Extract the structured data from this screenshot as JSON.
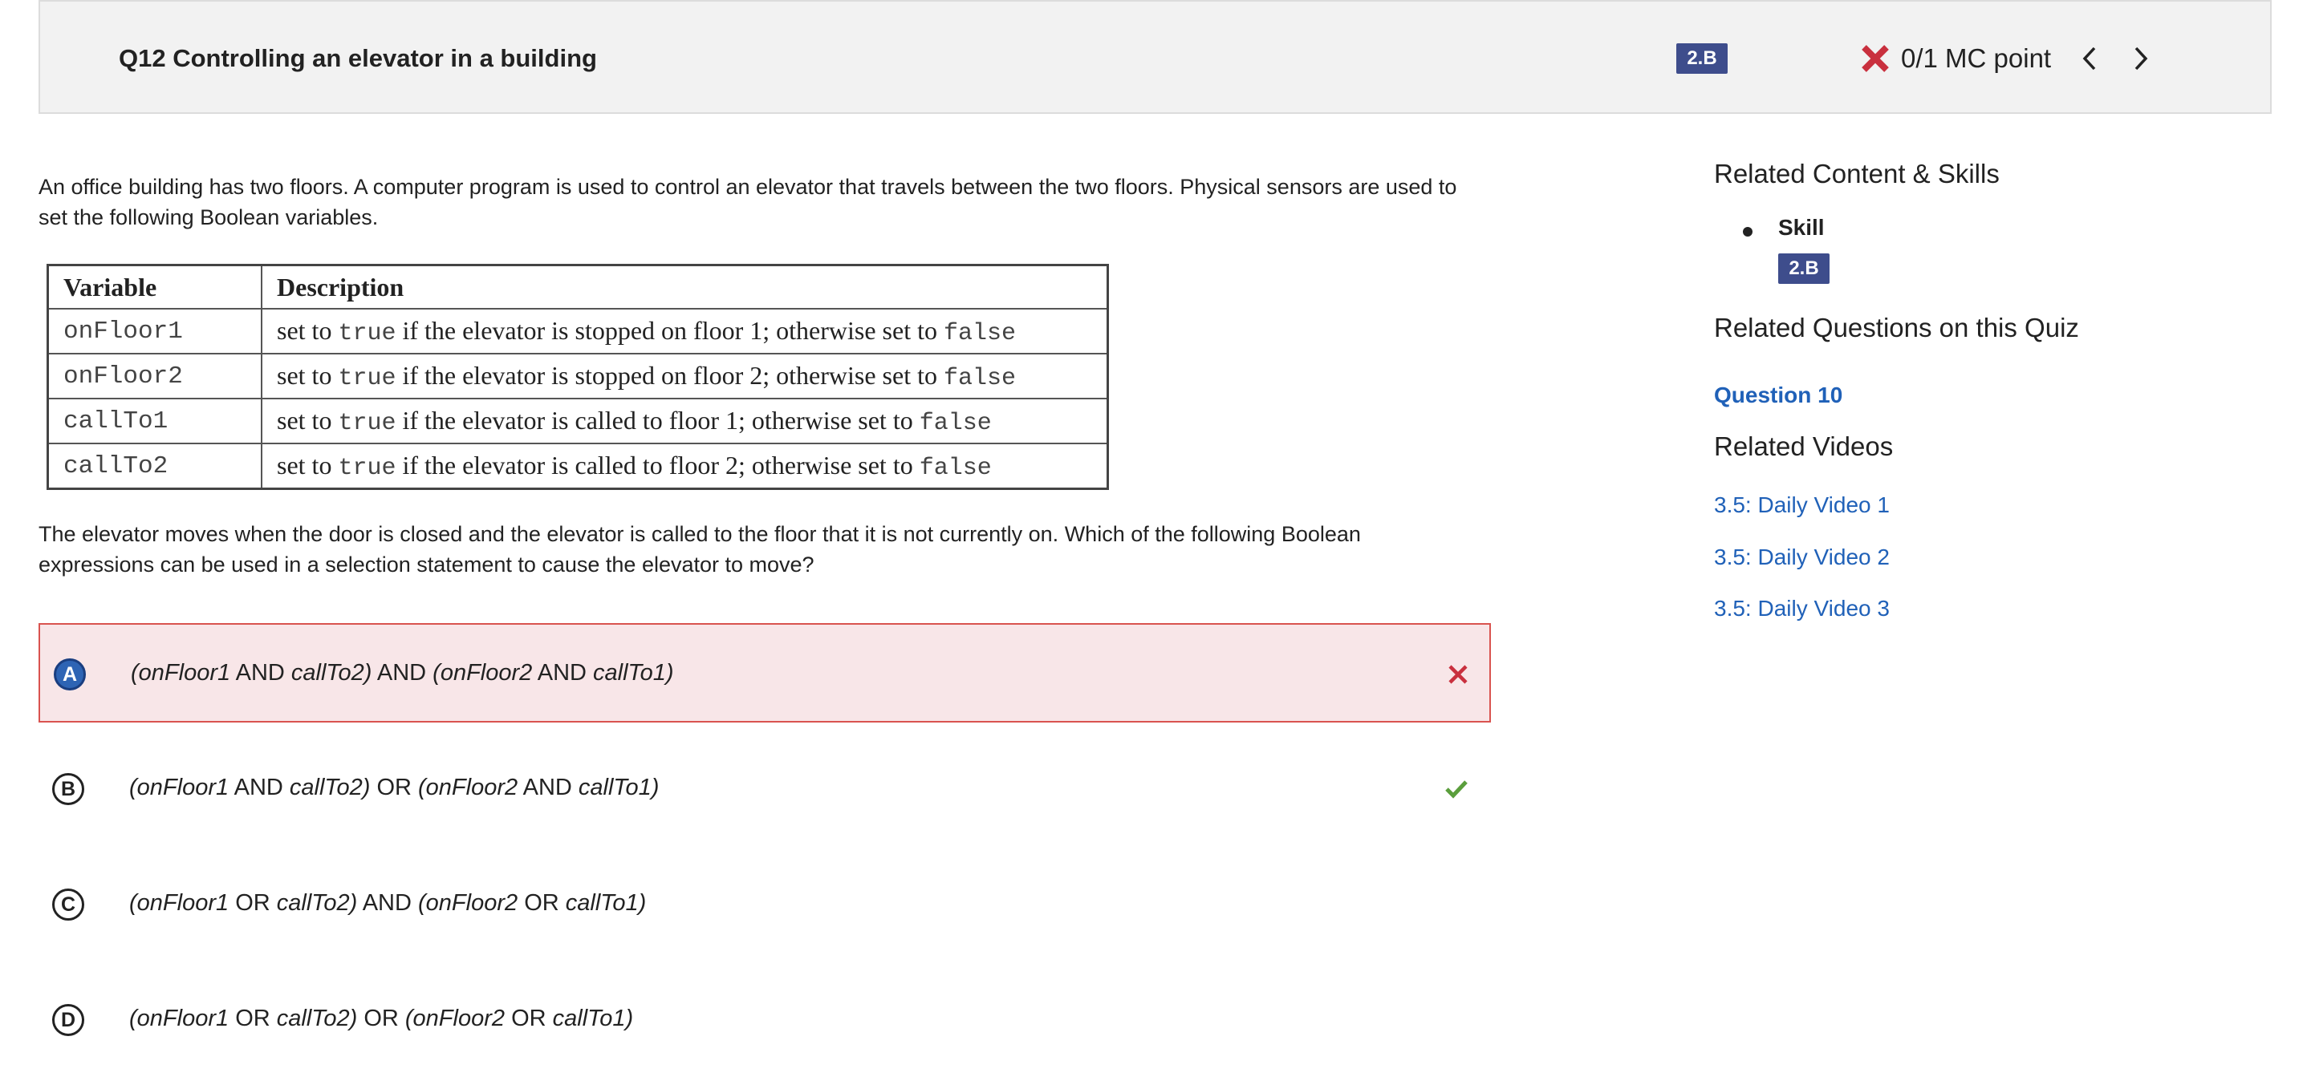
{
  "header": {
    "question_title": "Q12 Controlling an elevator in a building",
    "skill_badge": "2.B",
    "score_text": "0/1 MC point",
    "prev_icon": "chevron-left-icon",
    "next_icon": "chevron-right-icon",
    "status_icon": "x-mark-icon"
  },
  "question": {
    "prompt_intro": "An office building has two floors. A computer program is used to control an elevator that travels between the two floors. Physical sensors are used to set the following Boolean variables.",
    "prompt_question": "The elevator moves when the door is closed and the elevator is called to the floor that it is not currently on. Which of the following Boolean expressions can be used in a selection statement to cause the elevator to move?"
  },
  "variables_table": {
    "headers": [
      "Variable",
      "Description"
    ],
    "rows": [
      {
        "name": "onFloor1",
        "pre": "set to ",
        "true": "true",
        "mid": " if the elevator is stopped on floor 1; otherwise set to ",
        "false": "false"
      },
      {
        "name": "onFloor2",
        "pre": "set to ",
        "true": "true",
        "mid": " if the elevator is stopped on floor 2; otherwise set to ",
        "false": "false"
      },
      {
        "name": "callTo1",
        "pre": "set to ",
        "true": "true",
        "mid": " if the elevator is called to floor 1; otherwise set to ",
        "false": "false"
      },
      {
        "name": "callTo2",
        "pre": "set to ",
        "true": "true",
        "mid": " if the elevator is called to floor 2; otherwise set to ",
        "false": "false"
      }
    ]
  },
  "choices": [
    {
      "letter": "A",
      "v1": "onFloor1",
      "op1": "AND",
      "v2": "callTo2)",
      "join": "AND",
      "v3": "(onFloor2",
      "op2": "AND",
      "v4": "callTo1)",
      "status": "incorrect-selected",
      "mark_icon": "x-icon"
    },
    {
      "letter": "B",
      "v1": "onFloor1",
      "op1": "AND",
      "v2": "callTo2)",
      "join": "OR",
      "v3": "(onFloor2",
      "op2": "AND",
      "v4": "callTo1)",
      "status": "correct",
      "mark_icon": "checkmark-icon"
    },
    {
      "letter": "C",
      "v1": "onFloor1",
      "op1": "OR",
      "v2": "callTo2)",
      "join": "AND",
      "v3": "(onFloor2",
      "op2": "OR",
      "v4": "callTo1)",
      "status": "none"
    },
    {
      "letter": "D",
      "v1": "onFloor1",
      "op1": "OR",
      "v2": "callTo2)",
      "join": "OR",
      "v3": "(onFloor2",
      "op2": "OR",
      "v4": "callTo1)",
      "status": "none"
    }
  ],
  "sidebar": {
    "related_content_heading": "Related Content & Skills",
    "skill_label": "Skill",
    "skill_badge": "2.B",
    "related_questions_heading": "Related Questions on this Quiz",
    "related_question_link": "Question 10",
    "related_videos_heading": "Related Videos",
    "videos": [
      "3.5: Daily Video 1",
      "3.5: Daily Video 2",
      "3.5: Daily Video 3"
    ]
  },
  "colors": {
    "badge": "#3e4d8c",
    "wrong_bg": "#f8e6e8",
    "wrong_border": "#d9534f",
    "correct_green": "#5a9e3c",
    "link": "#2061b8"
  }
}
